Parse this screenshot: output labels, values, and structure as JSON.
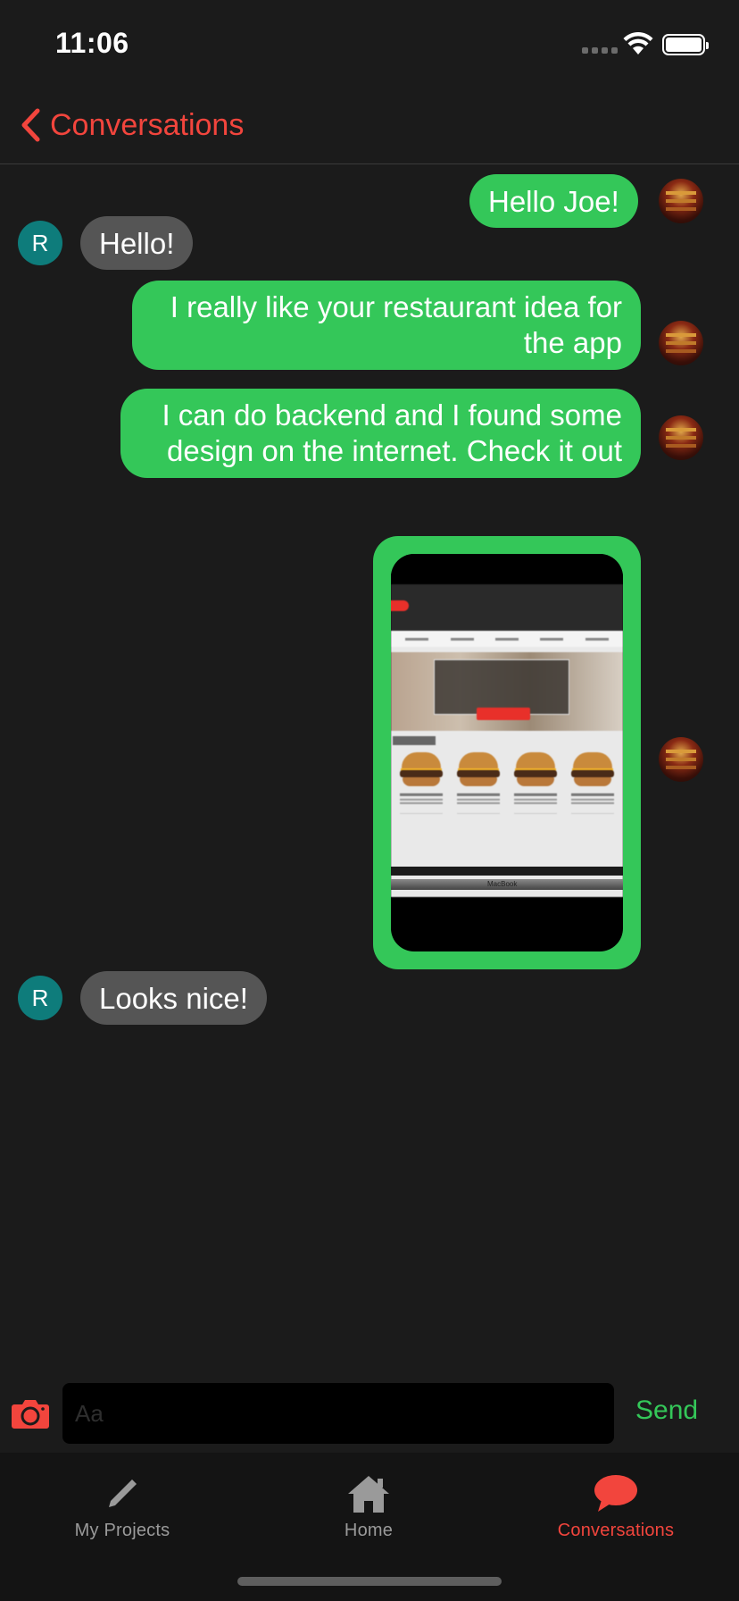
{
  "status_bar": {
    "time": "11:06"
  },
  "nav": {
    "back_label": "Conversations"
  },
  "messages": [
    {
      "direction": "outgoing",
      "text": "Hello Joe!"
    },
    {
      "direction": "incoming",
      "sender_initial": "R",
      "text": "Hello!"
    },
    {
      "direction": "outgoing",
      "text": "I really like your restaurant idea for the app"
    },
    {
      "direction": "outgoing",
      "text": "I can do backend and I found some design on the internet. Check it out"
    },
    {
      "direction": "outgoing",
      "type": "image",
      "image_caption": "MacBook"
    },
    {
      "direction": "incoming",
      "sender_initial": "R",
      "text": "Looks nice!"
    }
  ],
  "composer": {
    "placeholder": "Aa",
    "send_label": "Send"
  },
  "tabs": [
    {
      "label": "My Projects",
      "icon": "pencil-icon",
      "active": false
    },
    {
      "label": "Home",
      "icon": "house-icon",
      "active": false
    },
    {
      "label": "Conversations",
      "icon": "chat-bubble-icon",
      "active": true
    }
  ],
  "colors": {
    "accent_red": "#f2453d",
    "outgoing_bubble": "#34c759",
    "incoming_bubble": "#555555",
    "avatar_r": "#0e7c7b",
    "background": "#1b1b1b"
  }
}
